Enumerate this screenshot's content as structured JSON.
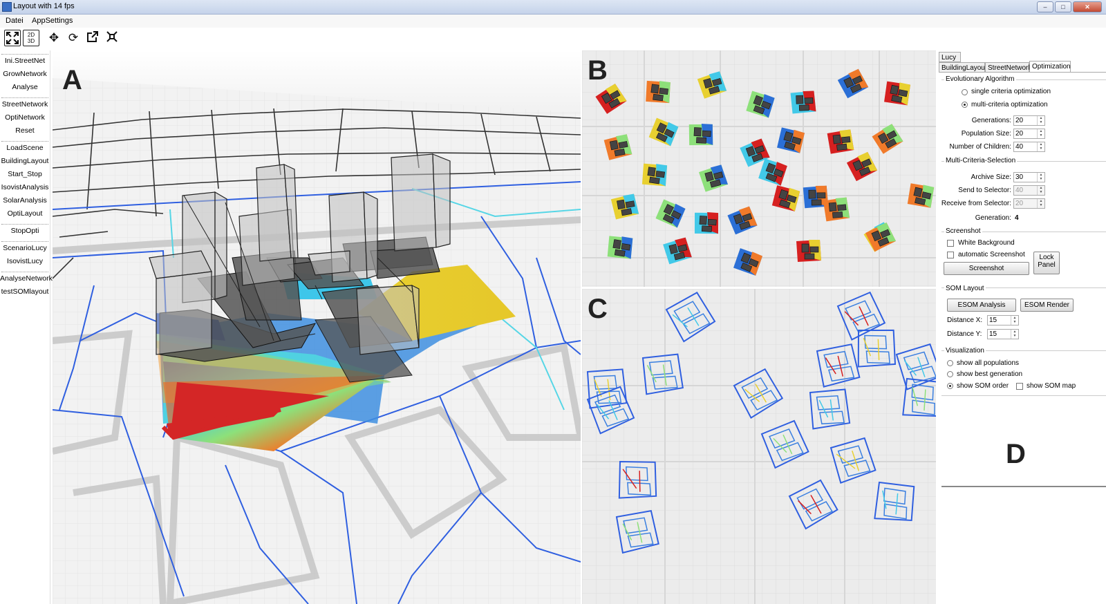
{
  "window": {
    "title": "Layout with 14 fps",
    "minimize": "‒",
    "maximize": "□",
    "close": "✕"
  },
  "menu": {
    "items": [
      "Datei",
      "AppSettings"
    ]
  },
  "toolbar": {
    "view2d3d": "2D 3D"
  },
  "sidebar": {
    "groups": [
      [
        "Ini.StreetNet",
        "GrowNetwork",
        "Analyse"
      ],
      [
        "StreetNetwork",
        "OptiNetwork",
        "Reset"
      ],
      [
        "LoadScene",
        "BuildingLayout",
        "Start_Stop",
        "IsovistAnalysis",
        "SolarAnalysis",
        "OptiLayout"
      ],
      [
        "StopOpti"
      ],
      [
        "ScenarioLucy",
        "IsovistLucy"
      ],
      [
        "AnalyseNetwork",
        "testSOMlayout"
      ]
    ]
  },
  "panels": {
    "a_label": "A",
    "b_label": "B",
    "c_label": "C",
    "d_label": "D"
  },
  "tabs": {
    "lucy": "Lucy",
    "building_layout": "BuildingLayout",
    "street_network": "StreetNetwork",
    "optimization": "Optimization"
  },
  "evolutionary": {
    "title": "Evolutionary Algorithm",
    "single": "single criteria optimization",
    "multi": "multi-criteria optimization",
    "generations_label": "Generations:",
    "generations": "20",
    "population_label": "Population Size:",
    "population": "20",
    "children_label": "Number of Children:",
    "children": "40"
  },
  "mcs": {
    "title": "Multi-Criteria-Selection",
    "archive_label": "Archive Size:",
    "archive": "30",
    "send_label": "Send to Selector:",
    "send": "40",
    "receive_label": "Receive from Selector:",
    "receive": "20",
    "generation_label": "Generation:",
    "generation": "4"
  },
  "screenshot": {
    "title": "Screenshot",
    "white_bg": "White Background",
    "auto": "automatic Screenshot",
    "button": "Screenshot",
    "lock": "Lock Panel"
  },
  "som": {
    "title": "SOM Layout",
    "esom_analysis": "ESOM Analysis",
    "esom_render": "ESOM Render",
    "dist_x_label": "Distance X:",
    "dist_x": "15",
    "dist_y_label": "Distance Y:",
    "dist_y": "15"
  },
  "visualization": {
    "title": "Visualization",
    "all_pop": "show all populations",
    "best_gen": "show best generation",
    "som_order": "show SOM order",
    "som_map": "show SOM map"
  }
}
